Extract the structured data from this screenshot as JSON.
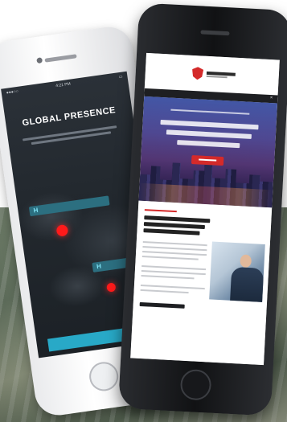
{
  "left_phone": {
    "status_time": "4:21 PM",
    "screen_title": "GLOBAL PRESENCE",
    "locations": [
      {
        "icon": "H"
      },
      {
        "icon": "H"
      }
    ]
  },
  "right_phone": {
    "menu_label": "",
    "close_glyph": "×"
  }
}
